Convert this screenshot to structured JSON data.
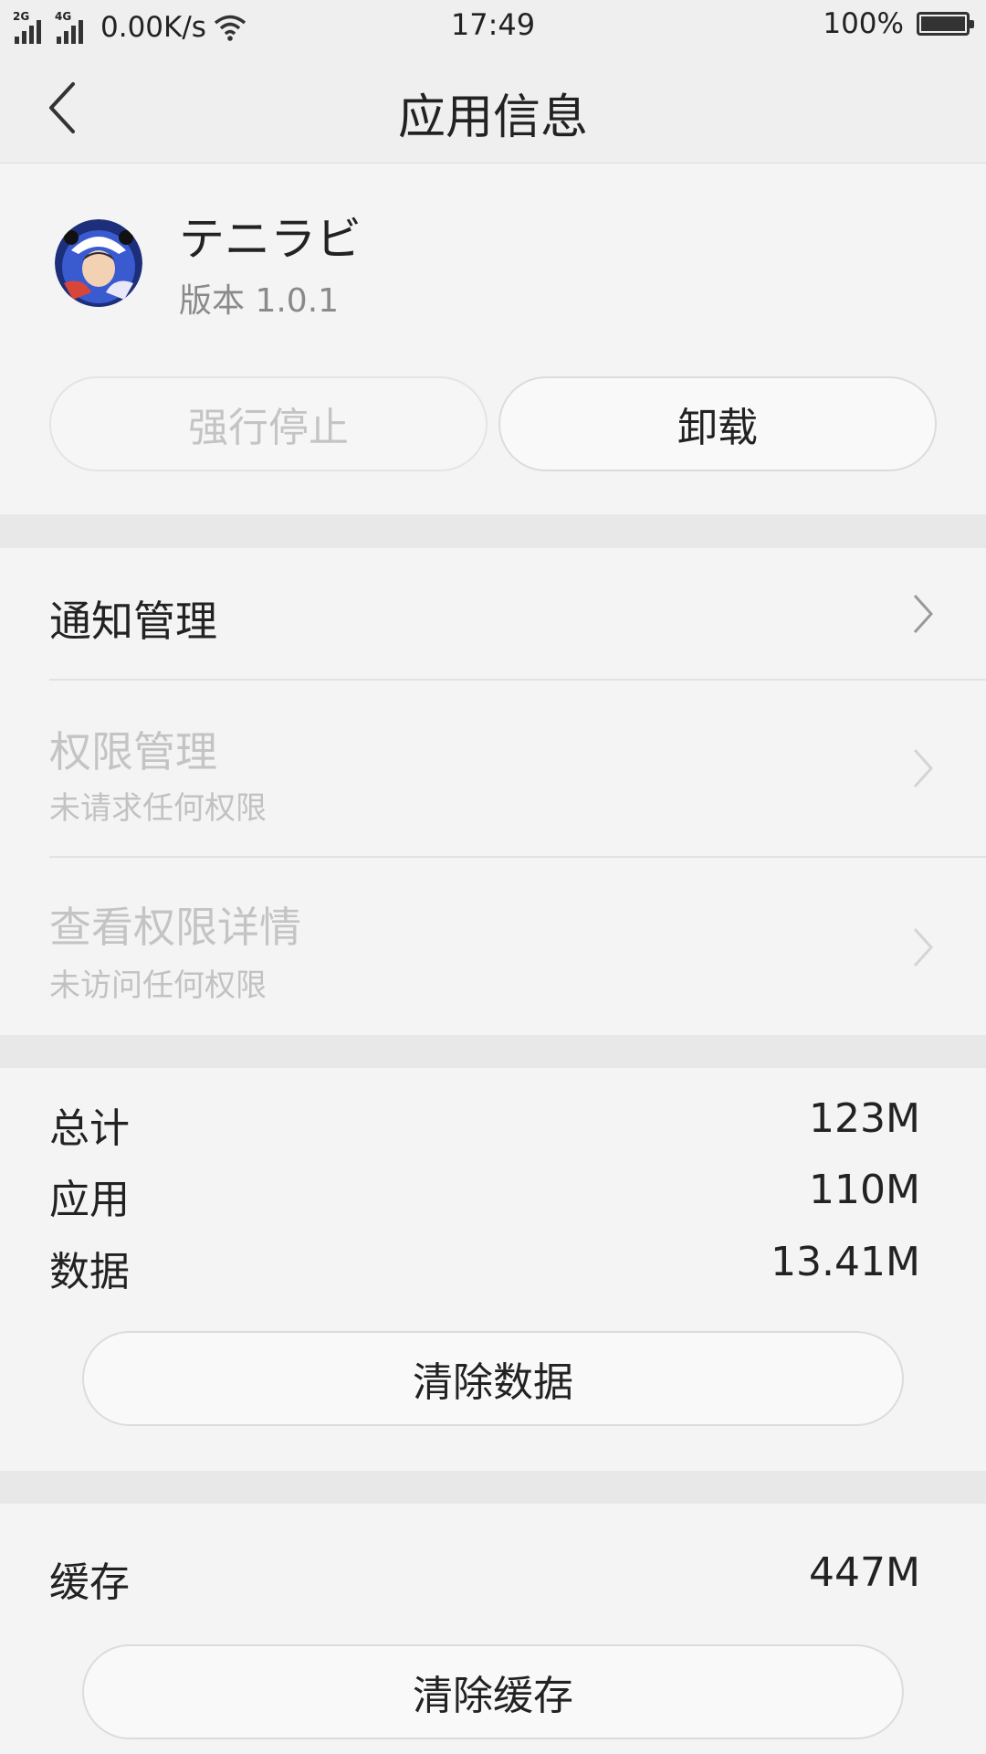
{
  "status_bar": {
    "sim1_label": "2G",
    "sim2_label": "4G",
    "net_speed": "0.00K/s",
    "time": "17:49",
    "battery": "100%"
  },
  "header": {
    "title": "应用信息"
  },
  "app": {
    "name": "テニラビ",
    "version": "版本 1.0.1"
  },
  "actions": {
    "force_stop": "强行停止",
    "uninstall": "卸载"
  },
  "settings": [
    {
      "label": "通知管理",
      "sub": ""
    },
    {
      "label": "权限管理",
      "sub": "未请求任何权限"
    },
    {
      "label": "查看权限详情",
      "sub": "未访问任何权限"
    }
  ],
  "storage": {
    "total_label": "总计",
    "total_value": "123M",
    "app_label": "应用",
    "app_value": "110M",
    "data_label": "数据",
    "data_value": "13.41M",
    "clear_data": "清除数据"
  },
  "cache": {
    "label": "缓存",
    "value": "447M",
    "clear_cache": "清除缓存"
  }
}
